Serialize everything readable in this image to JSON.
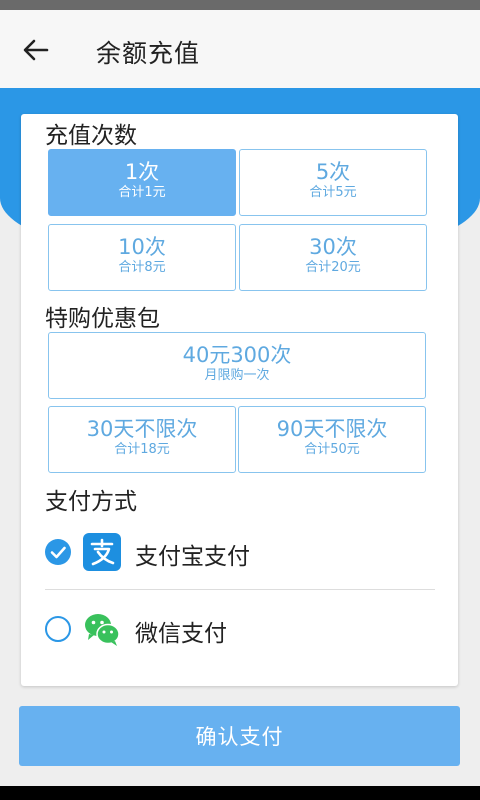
{
  "header": {
    "title": "余额充值",
    "back_icon": "arrow-left-icon"
  },
  "recharge": {
    "title": "充值次数",
    "options": [
      {
        "main": "1次",
        "sub": "合计1元",
        "selected": true
      },
      {
        "main": "5次",
        "sub": "合计5元",
        "selected": false
      },
      {
        "main": "10次",
        "sub": "合计8元",
        "selected": false
      },
      {
        "main": "30次",
        "sub": "合计20元",
        "selected": false
      }
    ]
  },
  "special": {
    "title": "特购优惠包",
    "options": [
      {
        "main": "40元300次",
        "sub": "月限购一次"
      },
      {
        "main": "30天不限次",
        "sub": "合计18元"
      },
      {
        "main": "90天不限次",
        "sub": "合计50元"
      }
    ]
  },
  "payment": {
    "title": "支付方式",
    "methods": [
      {
        "label": "支付宝支付",
        "icon": "alipay-icon",
        "checked": true
      },
      {
        "label": "微信支付",
        "icon": "wechat-icon",
        "checked": false
      }
    ]
  },
  "confirm_label": "确认支付",
  "colors": {
    "primary": "#2b97e6",
    "selected_fill": "#67b1f0",
    "option_text": "#5fa9e0",
    "option_border": "#88c4ee",
    "alipay": "#1d8fe0",
    "wechat": "#39c15c"
  }
}
